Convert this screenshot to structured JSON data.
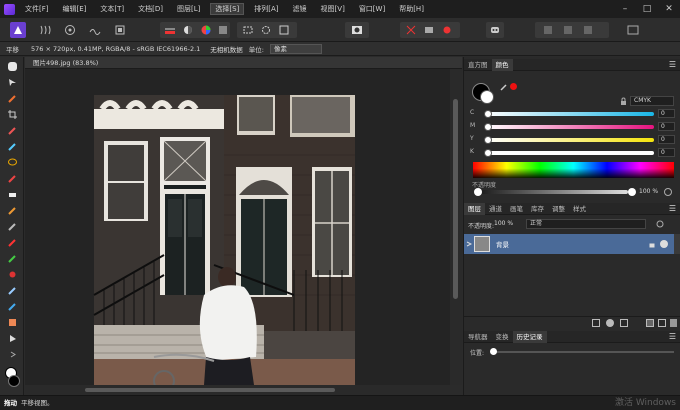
{
  "app": {
    "name": "Affinity Photo"
  },
  "menu": [
    {
      "label": "文件[F]"
    },
    {
      "label": "编辑[E]"
    },
    {
      "label": "文本[T]"
    },
    {
      "label": "文档[D]"
    },
    {
      "label": "图层[L]"
    },
    {
      "label": "选择[S]",
      "active": true
    },
    {
      "label": "排列[A]"
    },
    {
      "label": "滤镜"
    },
    {
      "label": "视图[V]"
    },
    {
      "label": "窗口[W]"
    },
    {
      "label": "帮助[H]"
    }
  ],
  "context": {
    "tool_name": "平移",
    "doc_info": "576 × 720px, 0.41MP, RGBA/8 - sRGB IEC61966-2.1",
    "camera_data": "无相机数据",
    "units_label": "单位:",
    "units_value": "像素"
  },
  "document": {
    "tab_title": "图片498.jpg (83.8%)"
  },
  "color_panel": {
    "tabs": [
      {
        "label": "直方图"
      },
      {
        "label": "颜色",
        "active": true
      }
    ],
    "mode": "CMYK",
    "channels": [
      {
        "label": "C",
        "value": "0"
      },
      {
        "label": "M",
        "value": "0"
      },
      {
        "label": "Y",
        "value": "0"
      },
      {
        "label": "K",
        "value": "0"
      }
    ],
    "opacity_label": "不透明度",
    "opacity_value": "100 %",
    "colors": {
      "cyan": "#19b6e6",
      "magenta": "#e6137f",
      "yellow": "#f4e30d",
      "black": "#ffffff",
      "accent_red": "#ee1111"
    }
  },
  "layers_panel": {
    "tabs": [
      {
        "label": "图层",
        "active": true
      },
      {
        "label": "通道"
      },
      {
        "label": "画笔"
      },
      {
        "label": "库存"
      },
      {
        "label": "调整"
      },
      {
        "label": "样式"
      }
    ],
    "opacity_label": "不透明度:",
    "opacity_value": "100 %",
    "blend_mode": "正常",
    "layers": [
      {
        "name": "背景",
        "selected": true
      }
    ]
  },
  "nav_panel": {
    "tabs": [
      {
        "label": "导航器"
      },
      {
        "label": "变换"
      },
      {
        "label": "历史记录",
        "active": true
      }
    ],
    "position_label": "位置:"
  },
  "status": {
    "tool": "拖动",
    "hint": "平移视图。",
    "watermark": "激活 Windows"
  }
}
